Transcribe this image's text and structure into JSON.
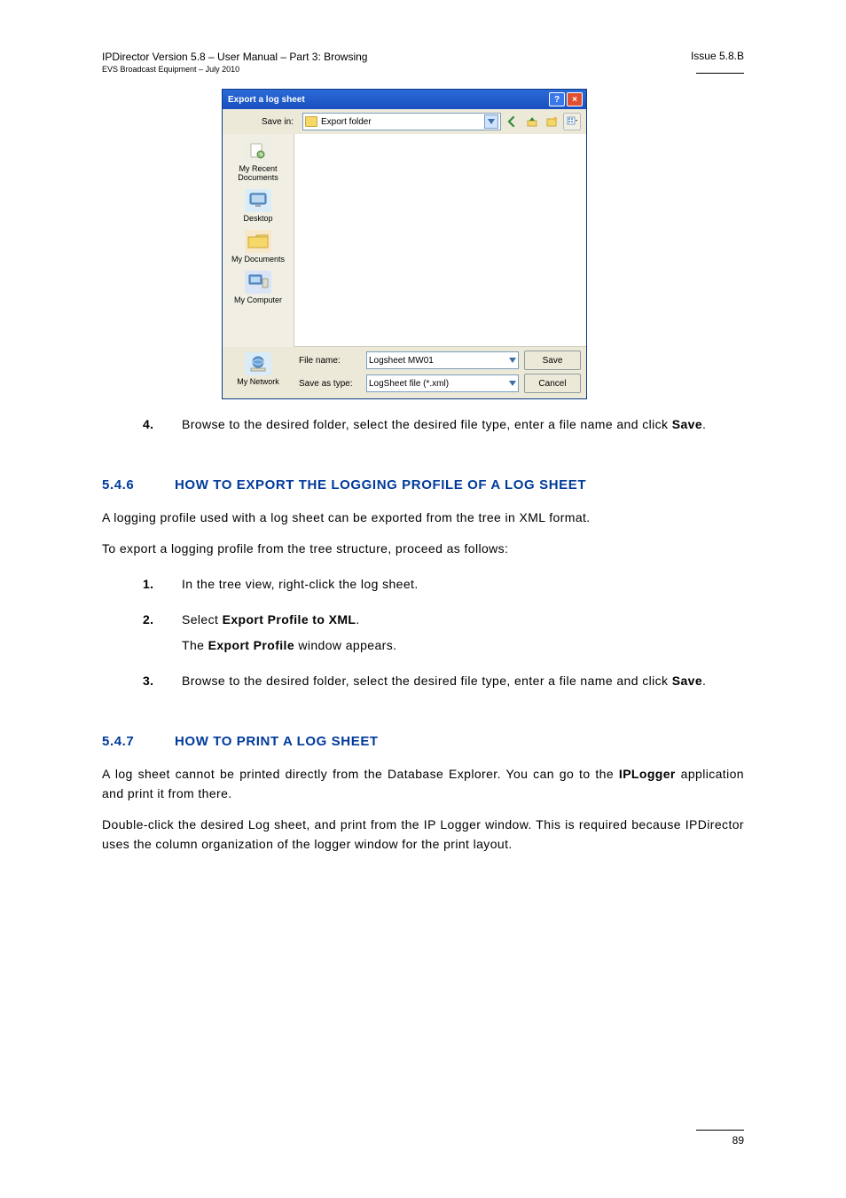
{
  "header": {
    "left_line1": "IPDirector Version 5.8 – User Manual – Part 3: Browsing",
    "left_line2": "EVS Broadcast Equipment – July 2010",
    "right": "Issue 5.8.B"
  },
  "dialog": {
    "title": "Export a log sheet",
    "help_glyph": "?",
    "close_glyph": "×",
    "savein_label": "Save in:",
    "savein_value": "Export folder",
    "places": {
      "recent": "My Recent Documents",
      "desktop": "Desktop",
      "documents": "My Documents",
      "computer": "My Computer",
      "network": "My Network"
    },
    "filename_label": "File name:",
    "filename_value": "Logsheet MW01",
    "savetype_label": "Save as type:",
    "savetype_value": "LogSheet file (*.xml)",
    "save_btn": "Save",
    "cancel_btn": "Cancel"
  },
  "content": {
    "p1a": "Browse to the desired folder, select the desired file type, enter a file name and click ",
    "p1b_bold": "Save",
    "p1c": ".",
    "p1_stepnum": "4.",
    "sec1": {
      "num": "5.4.6",
      "title": "HOW TO EXPORT THE LOGGING PROFILE OF A LOG SHEET"
    },
    "p2": "A logging profile used with a log sheet can be exported from the tree in XML format.",
    "p3": "To export a logging profile from the tree structure, proceed as follows:",
    "s1_num": "1.",
    "s1": "In the tree view, right-click the log sheet.",
    "s2_num": "2.",
    "s2a": "Select ",
    "s2b_bold": "Export Profile to XML",
    "s2c": ".",
    "s2d": "The ",
    "s2e_bold": "Export Profile",
    "s2f": " window appears.",
    "s3_num": "3.",
    "s3a": "Browse to the desired folder, select the desired file type, enter a file name and click ",
    "s3b_bold": "Save",
    "s3c": ".",
    "sec2": {
      "num": "5.4.7",
      "title": "HOW TO PRINT A LOG SHEET"
    },
    "p4a": "A log sheet cannot be printed directly from the Database Explorer. You can go to the ",
    "p4b_bold": "IPLogger",
    "p4c": " application and print it from there.",
    "p5": "Double-click the desired Log sheet, and print from the IP Logger window.  This is required because IPDirector uses the column organization of the logger window for the print layout."
  },
  "footer": {
    "page": "89"
  }
}
